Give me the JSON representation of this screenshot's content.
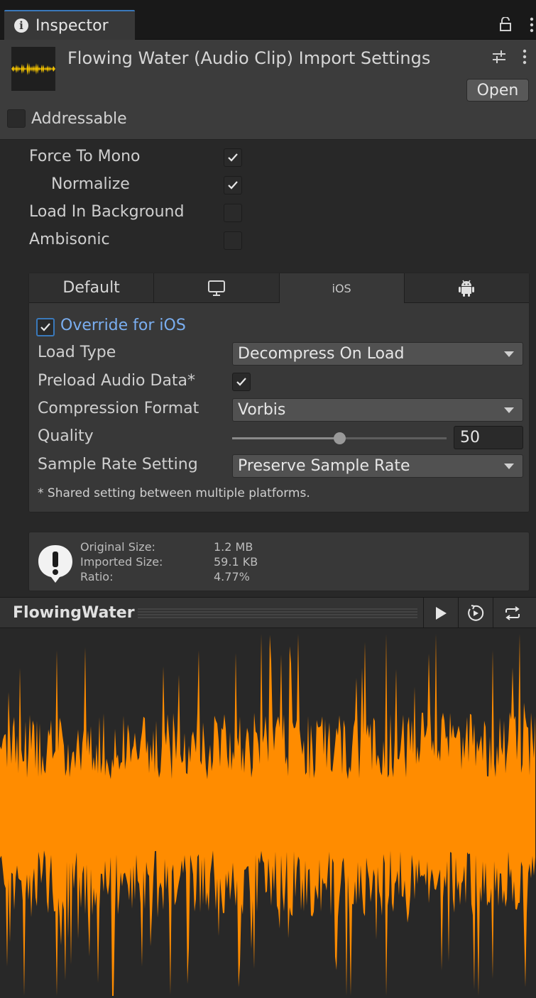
{
  "window": {
    "tab_title": "Inspector",
    "tab_icon": "info-icon",
    "lock_icon": "lock-icon",
    "menu_icon": "kebab-icon"
  },
  "header": {
    "title": "Flowing Water (Audio Clip) Import Settings",
    "open_label": "Open",
    "addressable_label": "Addressable",
    "addressable_checked": false
  },
  "properties": {
    "force_to_mono": {
      "label": "Force To Mono",
      "checked": true
    },
    "normalize": {
      "label": "Normalize",
      "checked": true
    },
    "load_in_background": {
      "label": "Load In Background",
      "checked": false
    },
    "ambisonic": {
      "label": "Ambisonic",
      "checked": false
    }
  },
  "platform_tabs": [
    {
      "label": "Default",
      "icon": null,
      "active": false
    },
    {
      "label": "",
      "icon": "monitor-icon",
      "active": false
    },
    {
      "label": "iOS",
      "icon": null,
      "active": true
    },
    {
      "label": "",
      "icon": "android-icon",
      "active": false
    }
  ],
  "platform": {
    "override_label": "Override for iOS",
    "override_checked": true,
    "load_type": {
      "label": "Load Type",
      "value": "Decompress On Load"
    },
    "preload_audio_data": {
      "label": "Preload Audio Data*",
      "checked": true
    },
    "compression_format": {
      "label": "Compression Format",
      "value": "Vorbis"
    },
    "quality": {
      "label": "Quality",
      "value": "50",
      "fraction": 0.5
    },
    "sample_rate_setting": {
      "label": "Sample Rate Setting",
      "value": "Preserve Sample Rate"
    },
    "footnote": "* Shared setting between multiple platforms."
  },
  "info": {
    "original_size_label": "Original Size:",
    "original_size": "1.2 MB",
    "imported_size_label": "Imported Size:",
    "imported_size": "59.1 KB",
    "ratio_label": "Ratio:",
    "ratio": "4.77%"
  },
  "preview": {
    "name": "FlowingWater",
    "play_icon": "play-icon",
    "autoplay_icon": "autoplay-icon",
    "loop_icon": "loop-icon"
  },
  "colors": {
    "accent": "#3a79bb",
    "waveform": "#ff8c00",
    "background": "#282828",
    "panel": "#383838"
  }
}
